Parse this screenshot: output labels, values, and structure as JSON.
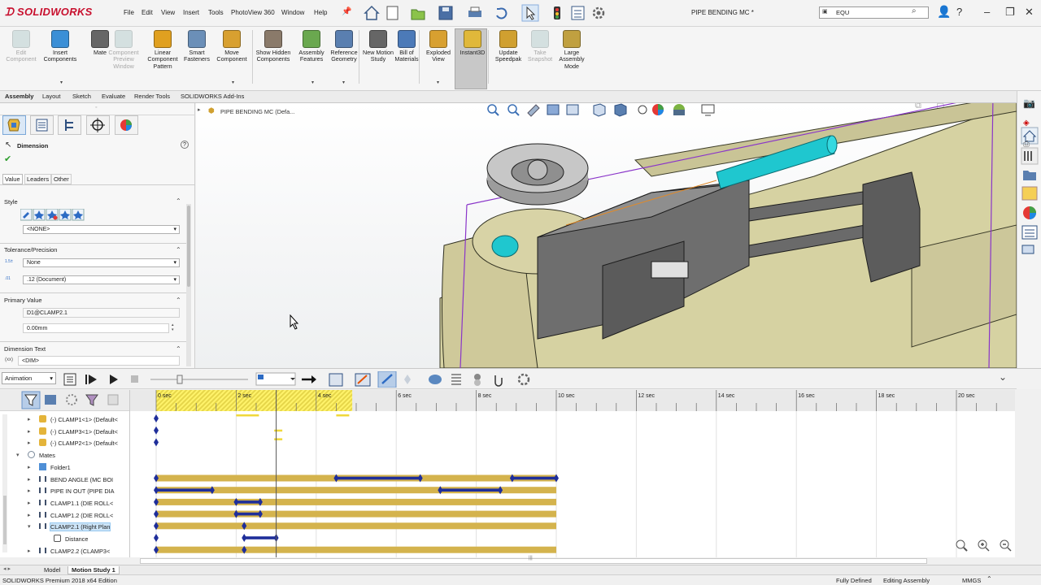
{
  "app": {
    "logo_text": "SOLIDWORKS",
    "document_title": "PIPE BENDING MC *",
    "search_value": "EQU",
    "menus": [
      "File",
      "Edit",
      "View",
      "Insert",
      "Tools",
      "PhotoView 360",
      "Window",
      "Help"
    ]
  },
  "commands": [
    {
      "label": "Edit Component",
      "icon": "edit-component-icon",
      "disabled": true
    },
    {
      "label": "Insert Components",
      "icon": "insert-components-icon",
      "disabled": false
    },
    {
      "label": "Mate",
      "icon": "mate-icon",
      "disabled": false
    },
    {
      "label": "Component Preview Window",
      "icon": "component-preview-icon",
      "disabled": true
    },
    {
      "label": "Linear Component Pattern",
      "icon": "linear-pattern-icon",
      "disabled": false
    },
    {
      "label": "Smart Fasteners",
      "icon": "smart-fasteners-icon",
      "disabled": false
    },
    {
      "label": "Move Component",
      "icon": "move-component-icon",
      "disabled": false
    },
    {
      "label": "Show Hidden Components",
      "icon": "show-hidden-icon",
      "disabled": false
    },
    {
      "label": "Assembly Features",
      "icon": "assembly-features-icon",
      "disabled": false
    },
    {
      "label": "Reference Geometry",
      "icon": "reference-geometry-icon",
      "disabled": false
    },
    {
      "label": "New Motion Study",
      "icon": "new-motion-study-icon",
      "disabled": false
    },
    {
      "label": "Bill of Materials",
      "icon": "bill-of-materials-icon",
      "disabled": false
    },
    {
      "label": "Exploded View",
      "icon": "exploded-view-icon",
      "disabled": false
    },
    {
      "label": "Instant3D",
      "icon": "instant3d-icon",
      "disabled": false
    },
    {
      "label": "Update Speedpak",
      "icon": "update-speedpak-icon",
      "disabled": false
    },
    {
      "label": "Take Snapshot",
      "icon": "take-snapshot-icon",
      "disabled": true
    },
    {
      "label": "Large Assembly Mode",
      "icon": "large-assembly-icon",
      "disabled": false
    }
  ],
  "command_tabs": [
    "Assembly",
    "Layout",
    "Sketch",
    "Evaluate",
    "Render Tools",
    "SOLIDWORKS Add-Ins"
  ],
  "property_manager": {
    "title": "Dimension",
    "tabs": [
      "Value",
      "Leaders",
      "Other"
    ],
    "style_label": "Style",
    "style_value": "<NONE>",
    "tolerance_label": "Tolerance/Precision",
    "tolerance_value": "None",
    "precision_value": ".12 (Document)",
    "primary_label": "Primary Value",
    "primary_name": "D1@CLAMP2.1",
    "primary_value": "0.00mm",
    "dimtext_label": "Dimension Text",
    "dimtext_value": "<DIM>"
  },
  "feature_tree": {
    "root": "PIPE BENDING MC  (Defa..."
  },
  "motion": {
    "study_type": "Animation",
    "time_labels": [
      "0 sec",
      "2 sec",
      "4 sec",
      "6 sec",
      "8 sec",
      "10 sec",
      "12 sec",
      "14 sec",
      "16 sec",
      "18 sec",
      "20 sec"
    ],
    "time_bar_seconds": 3,
    "tree_rows": [
      {
        "label": "(-) CLAMP1<1> (Default<",
        "indent": 1,
        "type": "part"
      },
      {
        "label": "(-) CLAMP3<1> (Default<",
        "indent": 1,
        "type": "part"
      },
      {
        "label": "(-) CLAMP2<1> (Default<",
        "indent": 1,
        "type": "part"
      },
      {
        "label": "Mates",
        "indent": 0,
        "type": "mates"
      },
      {
        "label": "Folder1",
        "indent": 1,
        "type": "folder"
      },
      {
        "label": "BEND ANGLE (MC BOI",
        "indent": 1,
        "type": "mate"
      },
      {
        "label": "PIPE IN OUT (PIPE DIA",
        "indent": 1,
        "type": "mate"
      },
      {
        "label": "CLAMP1.1 (DIE ROLL<",
        "indent": 1,
        "type": "mate"
      },
      {
        "label": "CLAMP1.2 (DIE ROLL<",
        "indent": 1,
        "type": "mate"
      },
      {
        "label": "CLAMP2.1 (Right Plan",
        "indent": 1,
        "type": "mate",
        "selected": true
      },
      {
        "label": "Distance",
        "indent": 2,
        "type": "dim"
      },
      {
        "label": "CLAMP2.2 (CLAMP3<",
        "indent": 1,
        "type": "mate"
      }
    ]
  },
  "bottom_tabs": [
    "Model",
    "Motion Study 1"
  ],
  "status": {
    "edition": "SOLIDWORKS Premium 2018 x64 Edition",
    "defined": "Fully Defined",
    "mode": "Editing Assembly",
    "units": "MMGS"
  },
  "colors": {
    "accent": "#c8102e",
    "bar": "#d4b34d",
    "keyline": "#1f2e9a",
    "playhead_zone": "#fff36a"
  }
}
